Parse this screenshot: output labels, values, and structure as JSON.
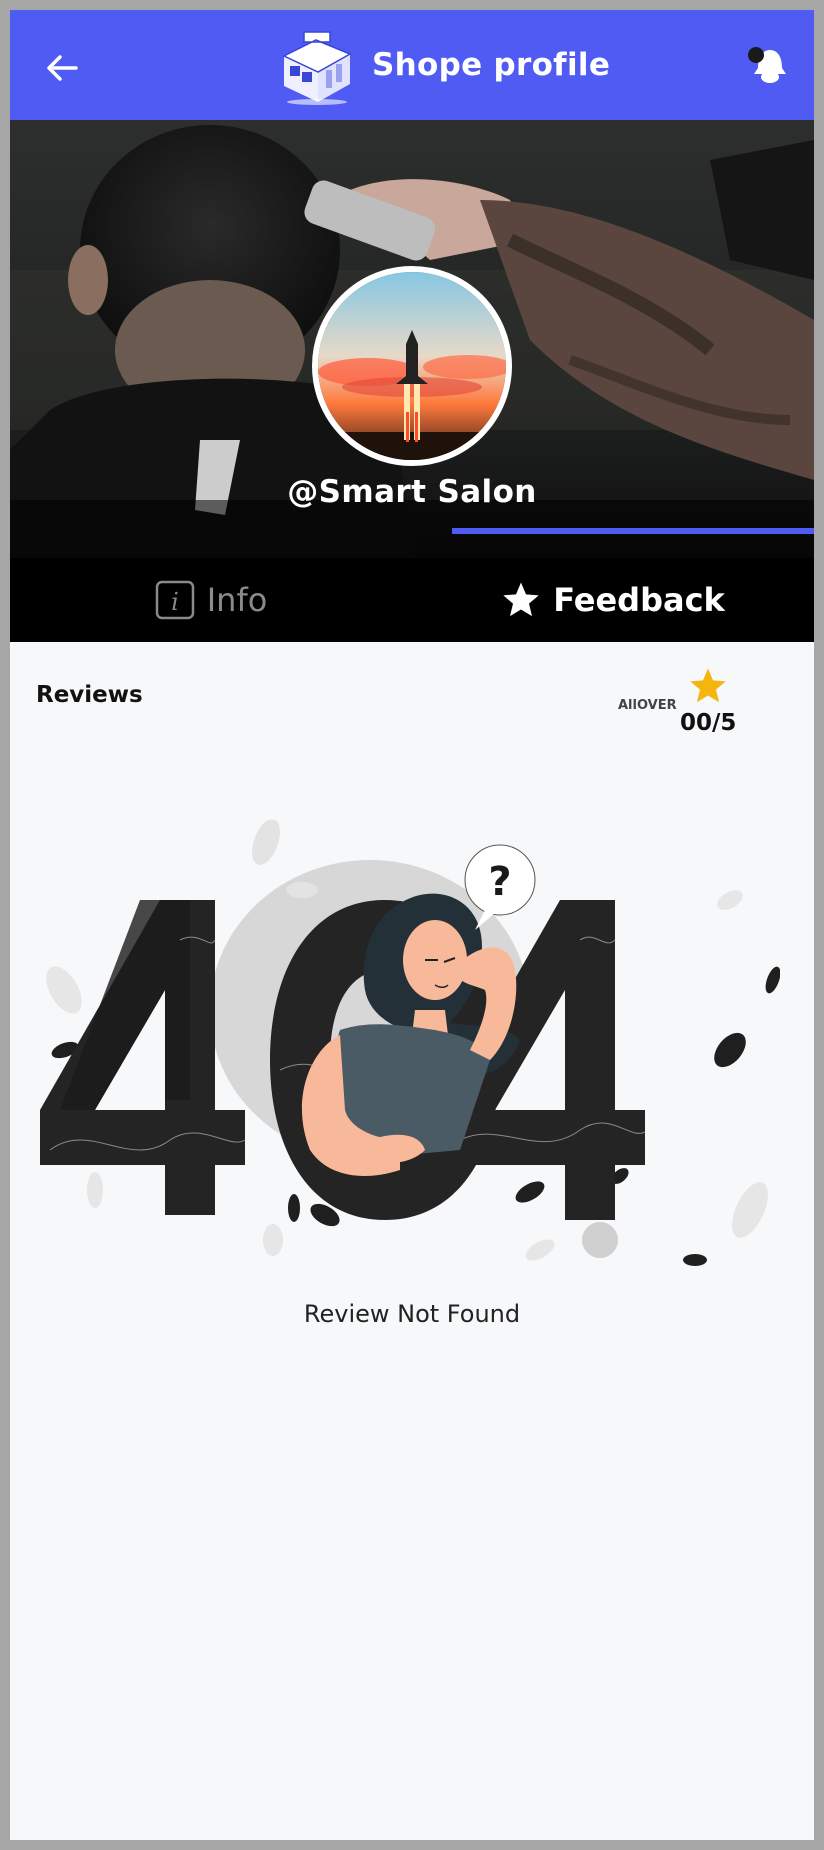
{
  "header": {
    "title": "Shope profile",
    "back_icon": "arrow-left-icon",
    "notification_icon": "bell-icon",
    "background_color": "#4f5bf2"
  },
  "profile": {
    "username": "@Smart Salon"
  },
  "tabs": [
    {
      "label": "Info",
      "icon": "info-icon",
      "active": false
    },
    {
      "label": "Feedback",
      "icon": "star-icon",
      "active": true
    }
  ],
  "reviews": {
    "title": "Reviews",
    "overall_label": "AllOVER",
    "rating": "00/5",
    "star_color": "#f6b40e",
    "empty_message": "Review Not Found"
  }
}
